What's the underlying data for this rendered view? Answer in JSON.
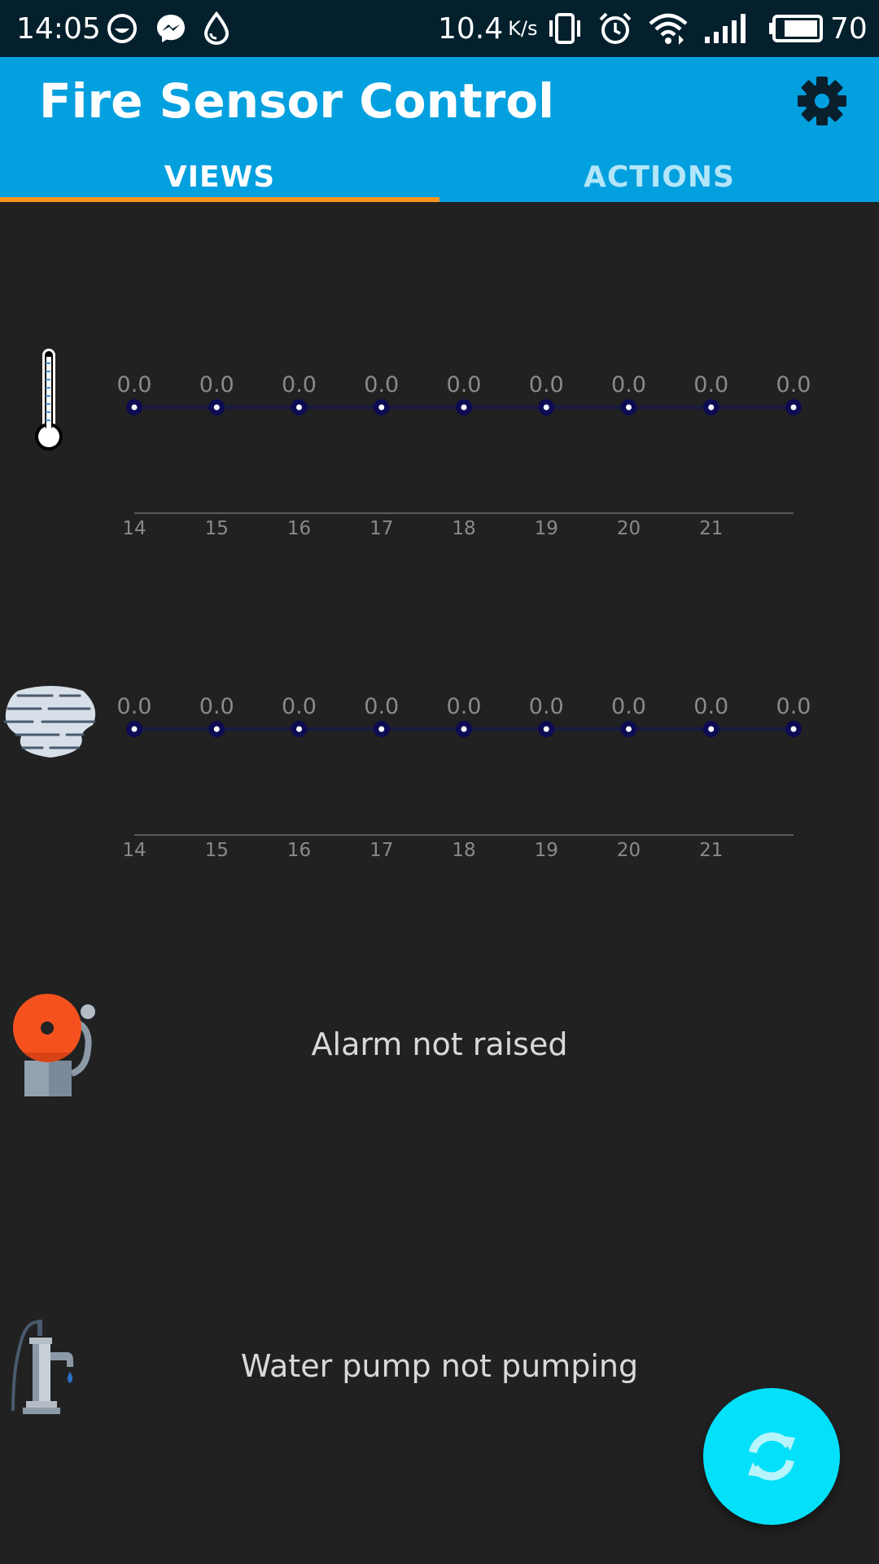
{
  "status_bar": {
    "time": "14:05",
    "speed": "10.4",
    "speed_unit": "K/s",
    "battery": "70",
    "icons": [
      "smiley-icon",
      "messenger-icon",
      "water-drop-icon",
      "vibrate-icon",
      "alarm-clock-icon",
      "wifi-icon",
      "signal-icon",
      "battery-icon"
    ]
  },
  "app_bar": {
    "title": "Fire Sensor Control",
    "settings_icon": "gear-icon",
    "background": "#03a0e0"
  },
  "tabs": [
    {
      "label": "VIEWS",
      "selected": true
    },
    {
      "label": "ACTIONS",
      "selected": false
    }
  ],
  "colors": {
    "background": "#212121",
    "tab_indicator": "#f7941d",
    "fab": "#03e0fa",
    "chart_line": "#1a1a40",
    "chart_point": "#0d0b52"
  },
  "sensors": [
    {
      "icon": "thermometer-icon"
    },
    {
      "icon": "smoke-cloud-icon"
    }
  ],
  "chart_data": [
    {
      "type": "line",
      "x_tick_labels": [
        "14",
        "15",
        "16",
        "17",
        "18",
        "19",
        "20",
        "21"
      ],
      "x": [
        14,
        15,
        16,
        17,
        18,
        19,
        20,
        21,
        22
      ],
      "values": [
        0.0,
        0.0,
        0.0,
        0.0,
        0.0,
        0.0,
        0.0,
        0.0,
        0.0
      ],
      "value_labels": [
        "0.0",
        "0.0",
        "0.0",
        "0.0",
        "0.0",
        "0.0",
        "0.0",
        "0.0",
        "0.0"
      ],
      "xlim": [
        14,
        22
      ],
      "grid": false
    },
    {
      "type": "line",
      "x_tick_labels": [
        "14",
        "15",
        "16",
        "17",
        "18",
        "19",
        "20",
        "21"
      ],
      "x": [
        14,
        15,
        16,
        17,
        18,
        19,
        20,
        21,
        22
      ],
      "values": [
        0.0,
        0.0,
        0.0,
        0.0,
        0.0,
        0.0,
        0.0,
        0.0,
        0.0
      ],
      "value_labels": [
        "0.0",
        "0.0",
        "0.0",
        "0.0",
        "0.0",
        "0.0",
        "0.0",
        "0.0",
        "0.0"
      ],
      "xlim": [
        14,
        22
      ],
      "grid": false
    }
  ],
  "alarm": {
    "icon": "alarm-bell-icon",
    "text": "Alarm not raised"
  },
  "pump": {
    "icon": "water-pump-icon",
    "text": "Water pump not pumping"
  },
  "fab": {
    "icon": "refresh-icon"
  }
}
